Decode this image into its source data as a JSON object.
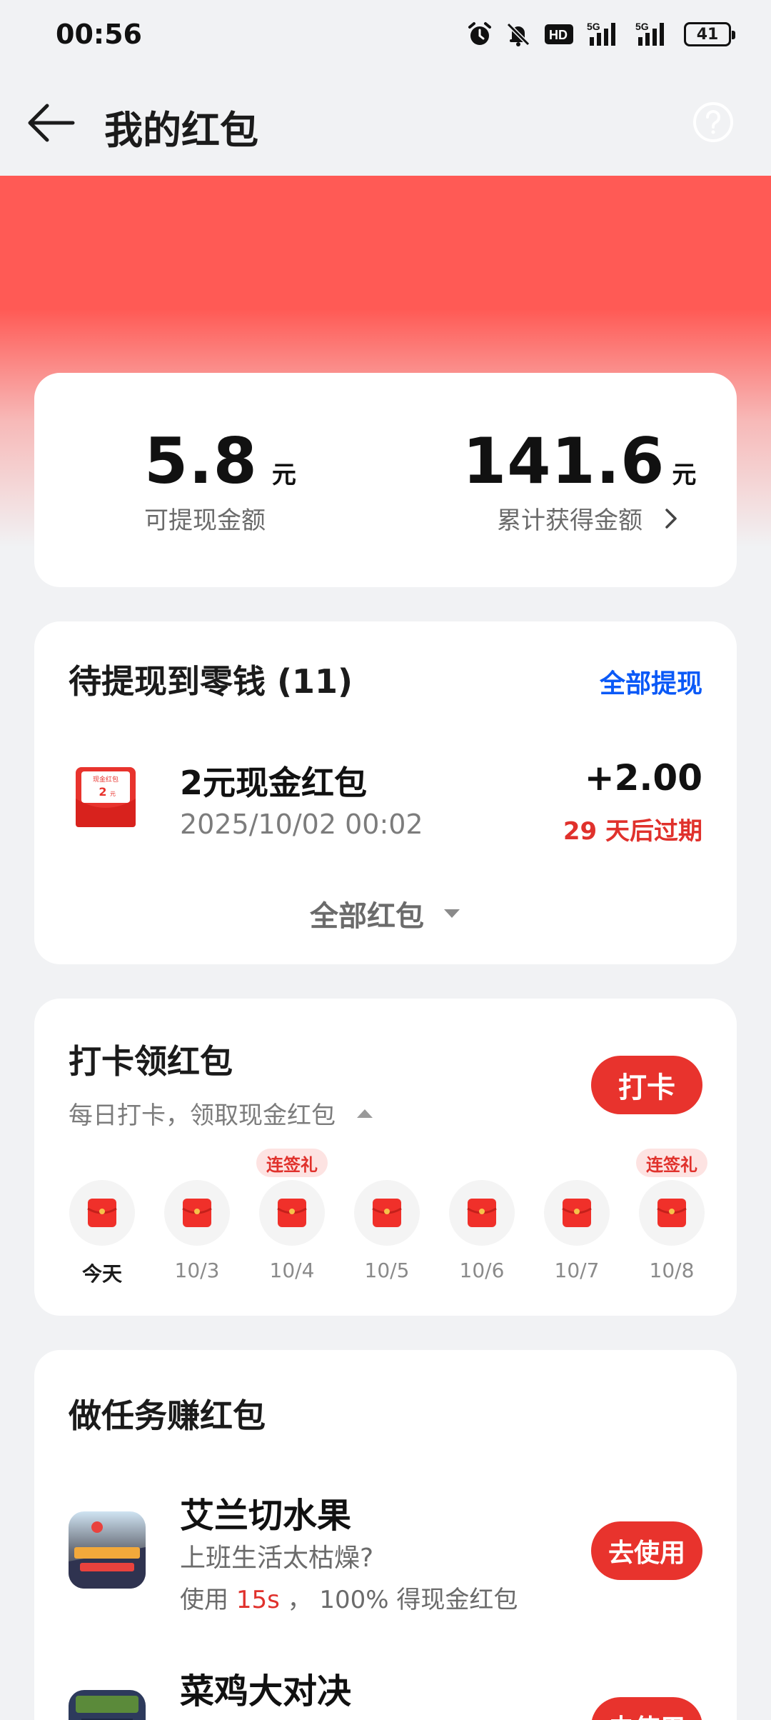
{
  "status_bar": {
    "time": "00:56",
    "network_1": "5G",
    "network_2": "5G",
    "hd_label": "HD",
    "battery": "41",
    "icons": [
      "alarm-icon",
      "bell-off-icon",
      "hd-icon",
      "signal-icon",
      "signal-icon",
      "battery-icon"
    ]
  },
  "header": {
    "title": "我的红包"
  },
  "summary": {
    "withdrawable_value": "5.8",
    "withdrawable_unit": "元",
    "withdrawable_label": "可提现金额",
    "total_value": "141.6",
    "total_unit": "元",
    "total_label": "累计获得金额"
  },
  "withdraw": {
    "title": "待提现到零钱 (11)",
    "action": "全部提现",
    "item": {
      "icon_label": "现金红包",
      "icon_amount": "2",
      "icon_unit": "元",
      "name": "2元现金红包",
      "date": "2025/10/02 00:02",
      "amount": "+2.00",
      "expire": "29 天后过期"
    },
    "all_packets": "全部红包"
  },
  "checkin": {
    "title": "打卡领红包",
    "subtitle": "每日打卡，领取现金红包",
    "button": "打卡",
    "days": [
      {
        "label": "今天",
        "badge": ""
      },
      {
        "label": "10/3",
        "badge": ""
      },
      {
        "label": "10/4",
        "badge": "连签礼"
      },
      {
        "label": "10/5",
        "badge": ""
      },
      {
        "label": "10/6",
        "badge": ""
      },
      {
        "label": "10/7",
        "badge": ""
      },
      {
        "label": "10/8",
        "badge": "连签礼"
      }
    ]
  },
  "tasks": {
    "title": "做任务赚红包",
    "items": [
      {
        "name": "艾兰切水果",
        "desc": "上班生活太枯燥?",
        "reward_prefix": "使用",
        "reward_time": "15s",
        "reward_suffix": "，  100% 得现金红包",
        "button": "去使用"
      },
      {
        "name": "菜鸡大对决",
        "desc": "",
        "reward_prefix": "",
        "reward_time": "",
        "reward_suffix": "",
        "button": "去使用"
      }
    ]
  },
  "colors": {
    "brand_red": "#e8332d",
    "band_red": "#ff5a55",
    "link_blue": "#0a59f7",
    "expire_red": "#e0312c"
  }
}
